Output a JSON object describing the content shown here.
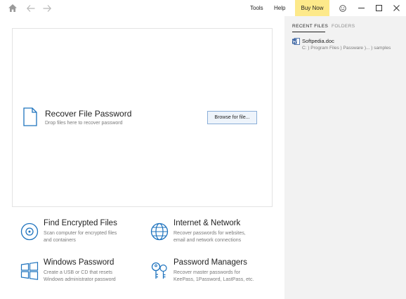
{
  "titlebar": {
    "menu": {
      "tools": "Tools",
      "help": "Help",
      "buy_now": "Buy Now"
    },
    "icons": [
      "home-icon",
      "back-arrow-icon",
      "forward-arrow-icon",
      "smiley-icon",
      "minimize-icon",
      "maximize-icon",
      "close-icon"
    ]
  },
  "recover": {
    "title": "Recover File Password",
    "subtitle": "Drop files here to recover password",
    "browse_label": "Browse for file..."
  },
  "tiles": [
    {
      "title": "Find Encrypted Files",
      "line1": "Scan computer for encrypted files",
      "line2": "and containers",
      "icon": "disk-search-icon"
    },
    {
      "title": "Internet & Network",
      "line1": "Recover passwords for websites,",
      "line2": "email and network connections",
      "icon": "globe-icon"
    },
    {
      "title": "Windows Password",
      "line1": "Create a USB or CD that resets",
      "line2": "Windows administrator password",
      "icon": "windows-logo-icon"
    },
    {
      "title": "Password Managers",
      "line1": "Recover master passwords for",
      "line2": "KeePass, 1Password, LastPass, etc.",
      "icon": "keys-icon"
    }
  ],
  "sidebar": {
    "tabs": [
      "RECENT FILES",
      "FOLDERS"
    ],
    "recent": [
      {
        "name": "Softpedia.doc",
        "path": "C: ) Program Files ) Passware )... ) samples",
        "icon": "word-document-icon"
      }
    ]
  },
  "colors": {
    "accent": "#1e73be",
    "buy_now_bg": "#fde98a",
    "sidebar_bg": "#f2f2f2",
    "word_blue": "#2b579a"
  }
}
